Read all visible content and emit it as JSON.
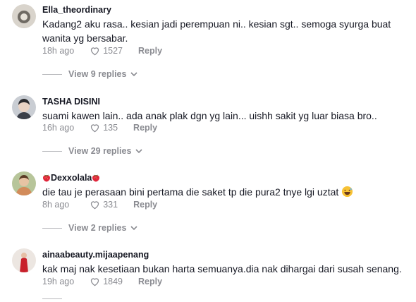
{
  "comments": [
    {
      "username": "Ella_theordinary",
      "text": "Kadang2 aku rasa.. kesian jadi perempuan ni.. kesian sgt.. semoga syurga buat wanita yg bersabar.",
      "time": "18h ago",
      "likes": "1527",
      "reply_label": "Reply",
      "view_replies": "View 9 replies"
    },
    {
      "username": "TASHA DISINI",
      "text": "suami kawen lain.. ada anak plak dgn yg lain... uishh sakit yg luar biasa bro..",
      "time": "16h ago",
      "likes": "135",
      "reply_label": "Reply",
      "view_replies": "View 29 replies"
    },
    {
      "username": "Dexxolala",
      "text": "die tau je perasaan bini pertama die saket tp die pura2 tnye lgi uztat",
      "time": "8h ago",
      "likes": "331",
      "reply_label": "Reply",
      "view_replies": "View 2 replies"
    },
    {
      "username": "ainaabeauty.mijaapenang",
      "text": "kak maj nak kesetiaan bukan harta semuanya.dia nak dihargai dari susah senang.",
      "time": "19h ago",
      "likes": "1849",
      "reply_label": "Reply"
    }
  ],
  "colors": {
    "text": "#161823",
    "muted": "#8a8b91",
    "strawberry": "#e0263b"
  },
  "icons": [
    "heart-outline-icon",
    "chevron-down-icon",
    "strawberry-icon",
    "grinning-sweat-emoji"
  ]
}
